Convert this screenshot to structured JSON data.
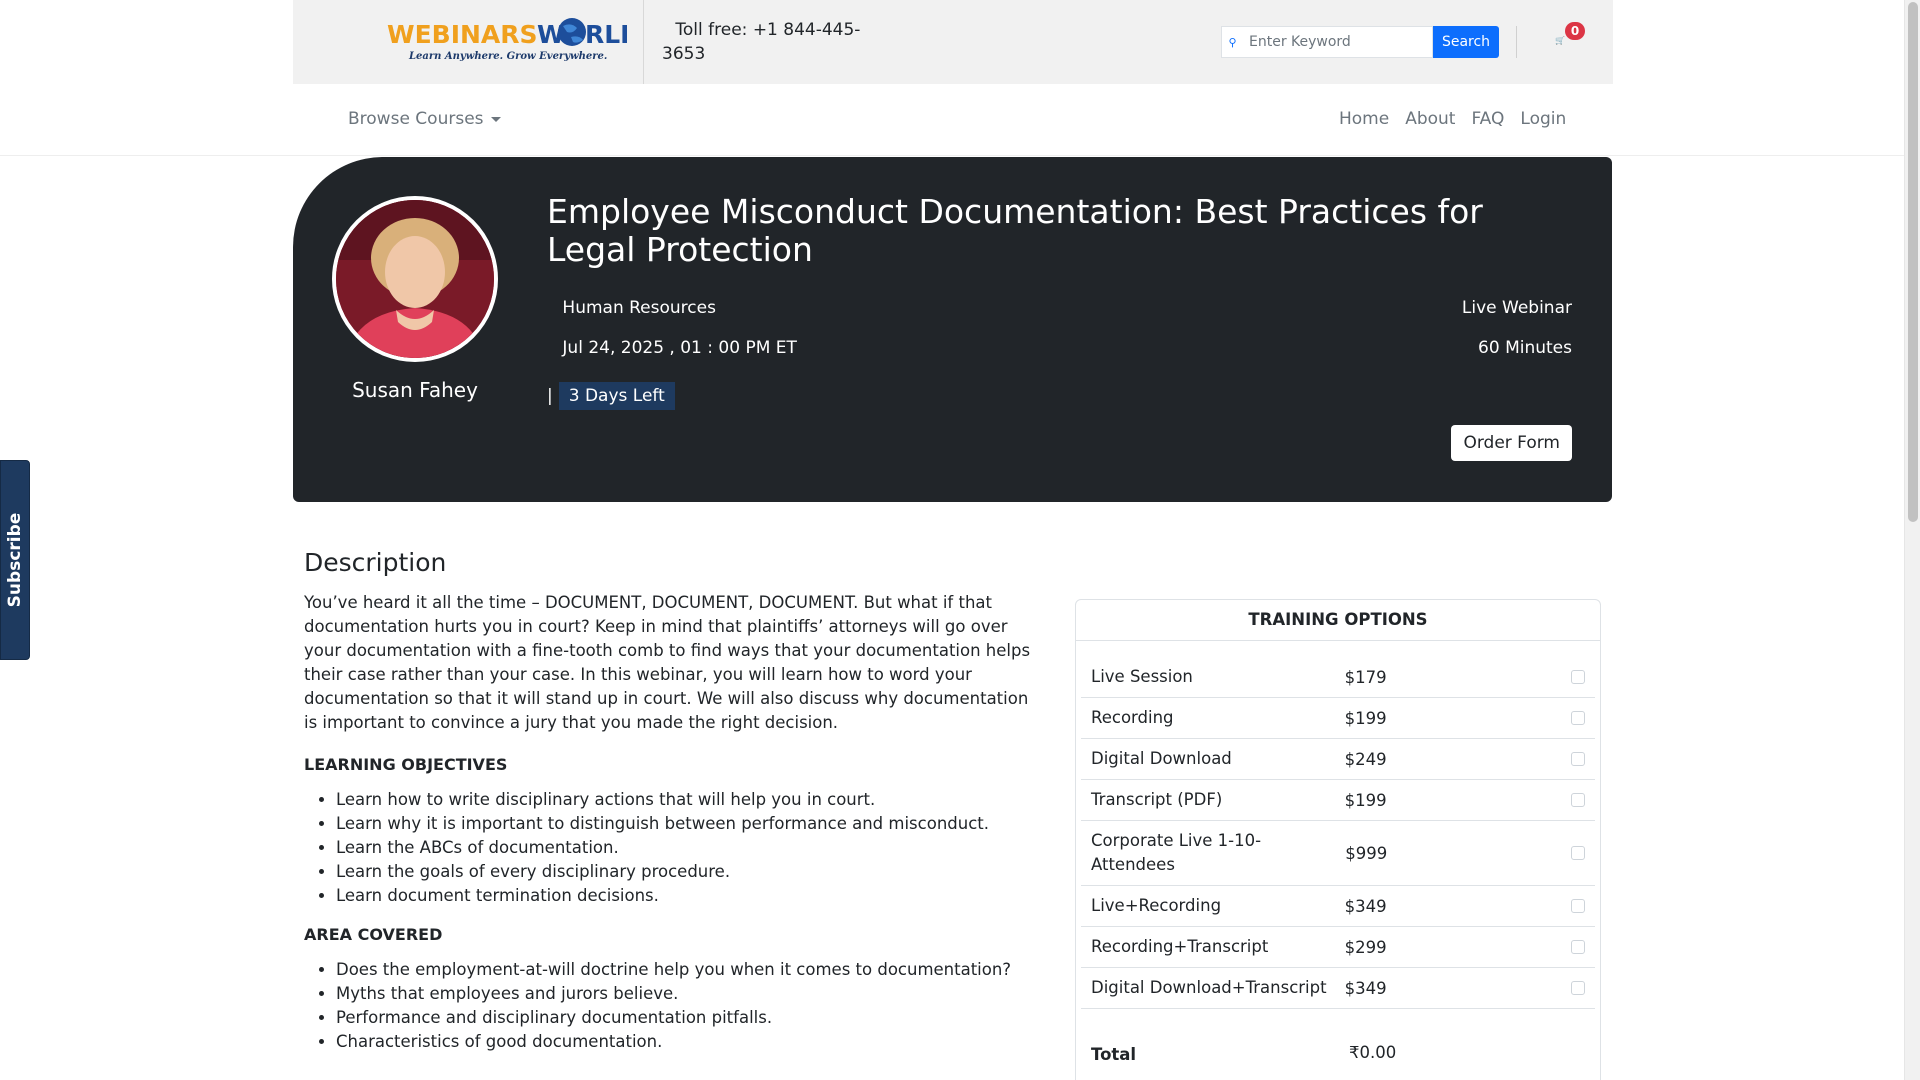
{
  "header": {
    "logo_text": "WEBINARS WORLD",
    "logo_tagline": "Learn Anywhere. Grow Everywhere.",
    "tollfree_label": "Toll free:",
    "tollfree_number": "+1 844-445-3653",
    "search_placeholder": "Enter Keyword",
    "search_button": "Search",
    "cart_count": "0"
  },
  "nav": {
    "browse_label": "Browse Courses",
    "links": [
      "Home",
      "About",
      "FAQ",
      "Login"
    ]
  },
  "course": {
    "speaker": "Susan Fahey",
    "title": "Employee Misconduct Documentation: Best Practices for Legal Protection",
    "category": "Human Resources",
    "type": "Live Webinar",
    "date": "Jul 24, 2025 , 01 : 00 PM ET",
    "duration": "60 Minutes",
    "separator": "|",
    "days_left": "3 Days Left",
    "order_button": "Order Form"
  },
  "subscribe_label": "Subscribe",
  "description": {
    "heading": "Description",
    "intro": "You’ve heard it all the time – DOCUMENT, DOCUMENT, DOCUMENT. But what if that documentation hurts you in court? Keep in mind that plaintiffs’ attorneys will go over your documentation with a fine-tooth comb to find ways that your documentation helps their case rather than your case. In this webinar, you will learn how to word your documentation so that it will stand up in court. We will also discuss why documentation is important to convince a jury that you made the right decision.",
    "objectives_heading": "LEARNING OBJECTIVES",
    "objectives": [
      "Learn how to write disciplinary actions that will help you in court.",
      "Learn why it is important to distinguish between performance and misconduct.",
      "Learn the ABCs of documentation.",
      "Learn the goals of every disciplinary procedure.",
      "Learn document termination decisions."
    ],
    "area_heading": "AREA COVERED",
    "areas": [
      "Does the employment-at-will doctrine help you when it comes to documentation?",
      "Myths that employees and jurors believe.",
      "Performance and disciplinary documentation pitfalls.",
      "Characteristics of good documentation."
    ]
  },
  "training": {
    "heading": "TRAINING OPTIONS",
    "options": [
      {
        "name": "Live Session",
        "price": "$179"
      },
      {
        "name": "Recording",
        "price": "$199"
      },
      {
        "name": "Digital Download",
        "price": "$249"
      },
      {
        "name": "Transcript (PDF)",
        "price": "$199"
      },
      {
        "name": "Corporate Live 1-10-Attendees",
        "price": "$999"
      },
      {
        "name": "Live+Recording",
        "price": "$349"
      },
      {
        "name": "Recording+Transcript",
        "price": "$299"
      },
      {
        "name": "Digital Download+Transcript",
        "price": "$349"
      }
    ],
    "total_label": "Total",
    "total_value": "₹0.00"
  }
}
